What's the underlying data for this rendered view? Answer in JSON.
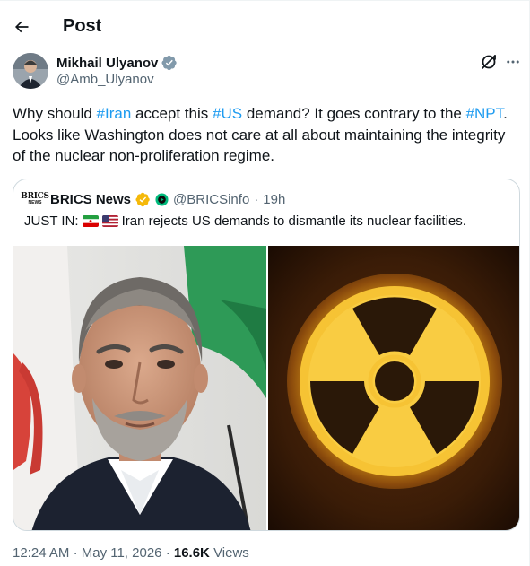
{
  "header": {
    "title": "Post"
  },
  "author": {
    "name": "Mikhail Ulyanov",
    "handle": "@Amb_Ulyanov",
    "verified": true
  },
  "tweet": {
    "segments": [
      {
        "text": "Why should "
      },
      {
        "text": "#Iran",
        "hashtag": true
      },
      {
        "text": " accept this "
      },
      {
        "text": "#US",
        "hashtag": true
      },
      {
        "text": " demand? It goes contrary to the "
      },
      {
        "text": "#NPT",
        "hashtag": true
      },
      {
        "text": ". Looks like Washington does not care at all about maintaining the integrity of the nuclear non-proliferation regime."
      }
    ]
  },
  "quote": {
    "logo_line1": "BRICS",
    "logo_line2": "NEWS",
    "name": "BRICS News",
    "handle": "@BRICSinfo",
    "separator": "·",
    "time": "19h",
    "prefix": "JUST IN:",
    "text": "Iran rejects US demands to dismantle its nuclear facilities."
  },
  "footer": {
    "time": "12:24 AM",
    "separator": "·",
    "date": "May 11, 2026",
    "views_count": "16.6K",
    "views_label": "Views"
  },
  "colors": {
    "accent": "#1d9bf0",
    "gold": "#f5b90a",
    "green": "#00ba7c",
    "text": "#0f1419",
    "muted": "#536471"
  },
  "icons": [
    "back-arrow-icon",
    "verified-badge-icon",
    "grok-icon",
    "more-icon",
    "gold-verified-icon",
    "affiliate-badge-icon",
    "iran-flag-icon",
    "us-flag-icon"
  ]
}
